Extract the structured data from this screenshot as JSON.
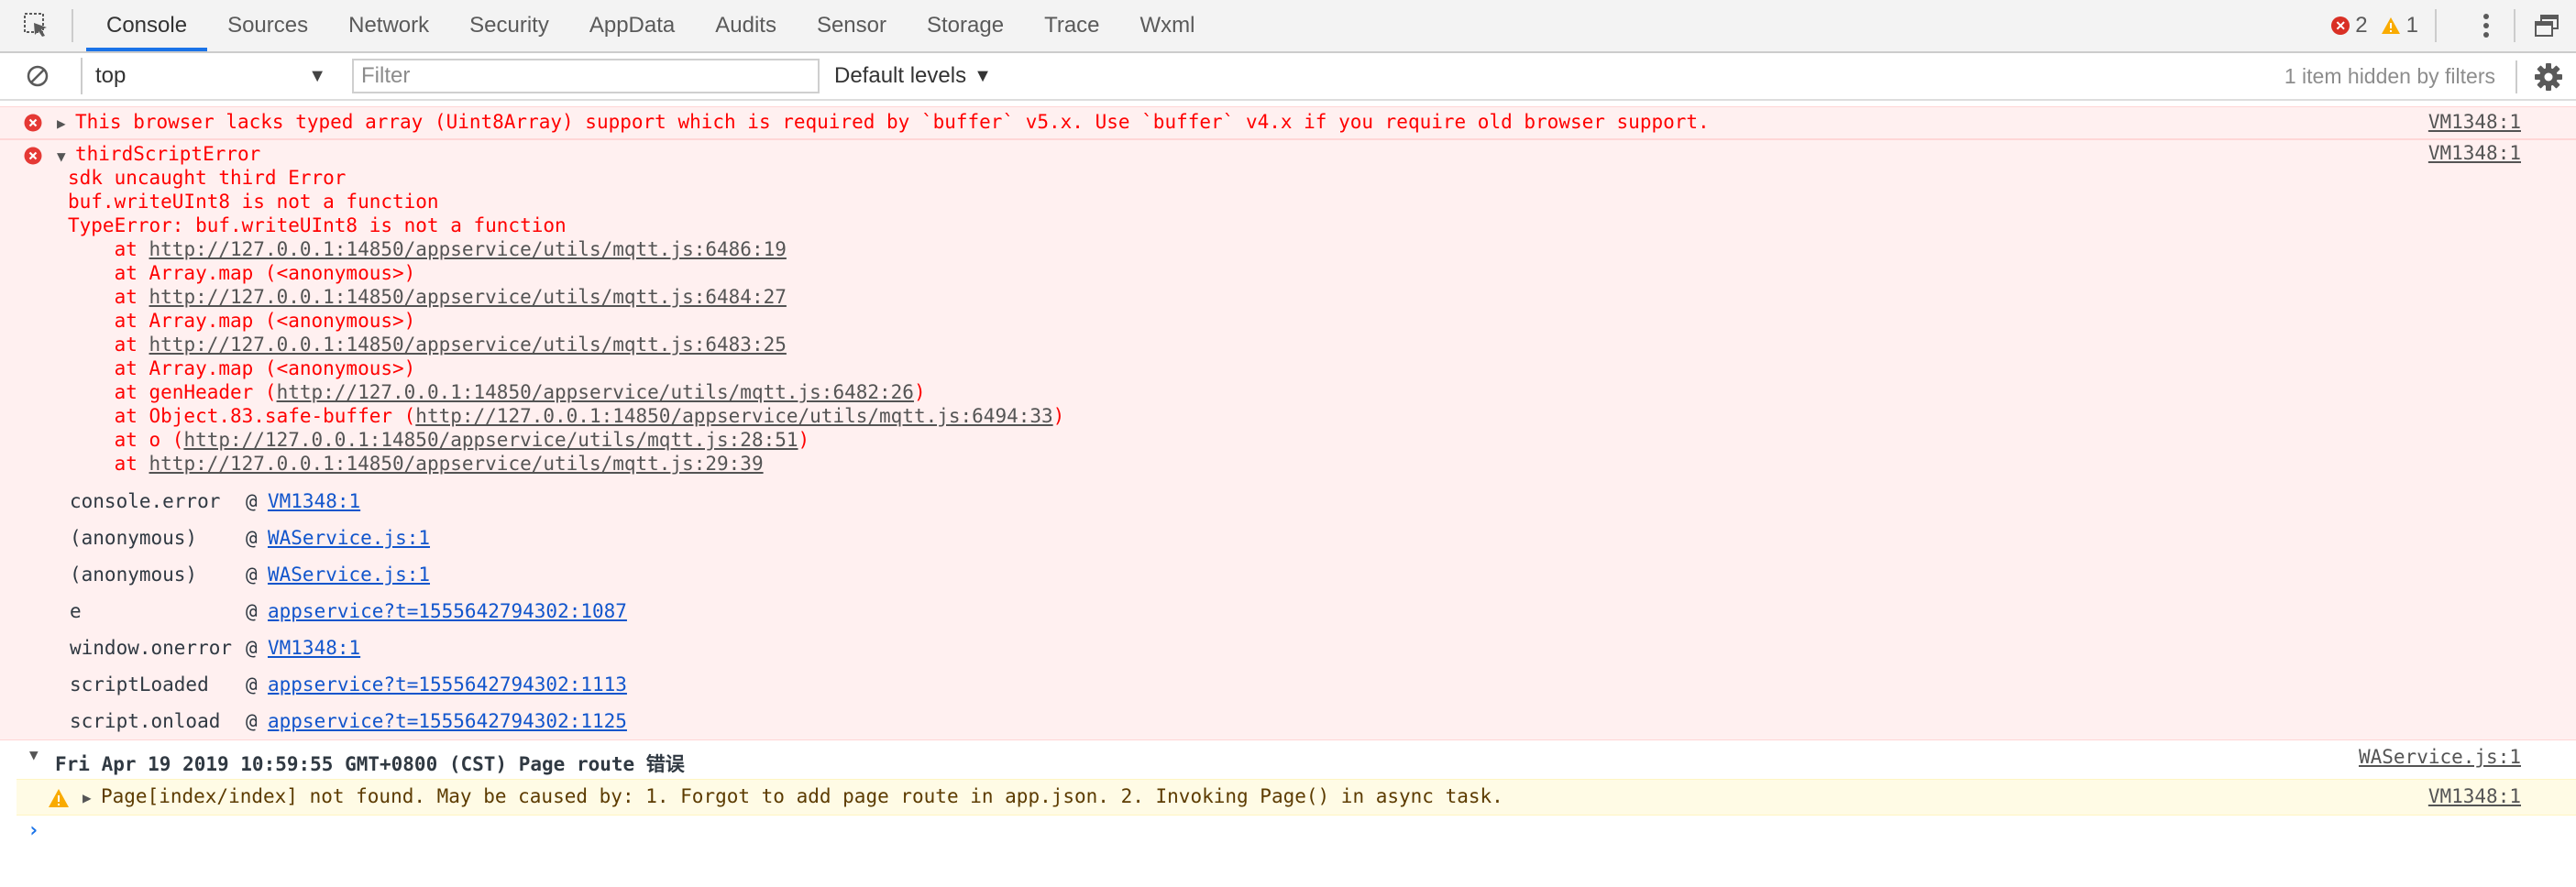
{
  "toolbar": {
    "tabs": [
      "Console",
      "Sources",
      "Network",
      "Security",
      "AppData",
      "Audits",
      "Sensor",
      "Storage",
      "Trace",
      "Wxml"
    ],
    "active_tab": "Console",
    "error_count": "2",
    "warning_count": "1"
  },
  "filterbar": {
    "context_value": "top",
    "filter_placeholder": "Filter",
    "levels_label": "Default levels",
    "hidden_label": "1 item hidden by filters"
  },
  "messages": {
    "buffer_error": {
      "text": "This browser lacks typed array (Uint8Array) support which is required by `buffer` v5.x. Use `buffer` v4.x if you require old browser support.",
      "source": "VM1348:1"
    },
    "third_script_error": {
      "title": "thirdScriptError",
      "source": "VM1348:1",
      "line1": "sdk uncaught third Error",
      "line2": "buf.writeUInt8 is not a function",
      "line3": "TypeError: buf.writeUInt8 is not a function",
      "stack": [
        {
          "pre": "    at ",
          "link": "http://127.0.0.1:14850/appservice/utils/mqtt.js:6486:19",
          "post": ""
        },
        {
          "pre": "    at Array.map (<anonymous>)",
          "link": "",
          "post": ""
        },
        {
          "pre": "    at ",
          "link": "http://127.0.0.1:14850/appservice/utils/mqtt.js:6484:27",
          "post": ""
        },
        {
          "pre": "    at Array.map (<anonymous>)",
          "link": "",
          "post": ""
        },
        {
          "pre": "    at ",
          "link": "http://127.0.0.1:14850/appservice/utils/mqtt.js:6483:25",
          "post": ""
        },
        {
          "pre": "    at Array.map (<anonymous>)",
          "link": "",
          "post": ""
        },
        {
          "pre": "    at genHeader (",
          "link": "http://127.0.0.1:14850/appservice/utils/mqtt.js:6482:26",
          "post": ")"
        },
        {
          "pre": "    at Object.83.safe-buffer (",
          "link": "http://127.0.0.1:14850/appservice/utils/mqtt.js:6494:33",
          "post": ")"
        },
        {
          "pre": "    at o (",
          "link": "http://127.0.0.1:14850/appservice/utils/mqtt.js:28:51",
          "post": ")"
        },
        {
          "pre": "    at ",
          "link": "http://127.0.0.1:14850/appservice/utils/mqtt.js:29:39",
          "post": ""
        }
      ],
      "trace": [
        {
          "fn": "console.error",
          "at": "@",
          "link": "VM1348:1"
        },
        {
          "fn": "(anonymous)",
          "at": "@",
          "link": "WAService.js:1"
        },
        {
          "fn": "(anonymous)",
          "at": "@",
          "link": "WAService.js:1"
        },
        {
          "fn": "e",
          "at": "@",
          "link": "appservice?t=1555642794302:1087"
        },
        {
          "fn": "window.onerror",
          "at": "@",
          "link": "VM1348:1"
        },
        {
          "fn": "scriptLoaded",
          "at": "@",
          "link": "appservice?t=1555642794302:1113"
        },
        {
          "fn": "script.onload",
          "at": "@",
          "link": "appservice?t=1555642794302:1125"
        }
      ]
    },
    "group": {
      "title": "Fri Apr 19 2019 10:59:55 GMT+0800 (CST) Page route 错误",
      "source": "WAService.js:1"
    },
    "page_warning": {
      "text": "Page[index/index] not found. May be caused by: 1. Forgot to add page route in app.json. 2. Invoking Page() in async task.",
      "source": "VM1348:1"
    }
  },
  "prompt_symbol": "›",
  "colors": {
    "accent": "#1a73e8",
    "error_bg": "#fff0f0",
    "error_text": "#ff0000",
    "warning_bg": "#fffbe5",
    "warning_icon": "#f9ab00",
    "link": "#1155cc"
  }
}
